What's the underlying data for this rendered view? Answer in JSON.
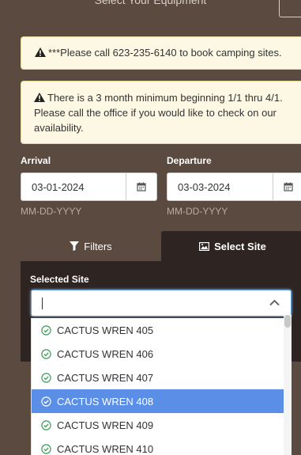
{
  "header": {
    "partial_title": "Select Your Equipment"
  },
  "alerts": {
    "phone_notice": "***Please call 623-235-6140 to book camping sites.",
    "minimum_notice": "There is a 3 month minimum beginning 1/1 thru 4/1. Please call the office if you would like to check on our availability."
  },
  "arrival": {
    "label": "Arrival",
    "value": "03-01-2024",
    "hint": "MM-DD-YYYY"
  },
  "departure": {
    "label": "Departure",
    "value": "03-03-2024",
    "hint": "MM-DD-YYYY"
  },
  "tabs": {
    "filters": "Filters",
    "select_site": "Select Site"
  },
  "site_select": {
    "label": "Selected Site",
    "value": "",
    "options": [
      "CACTUS WREN 405",
      "CACTUS WREN 406",
      "CACTUS WREN 407",
      "CACTUS WREN 408",
      "CACTUS WREN 409",
      "CACTUS WREN 410"
    ],
    "highlighted": "CACTUS WREN 408"
  },
  "colors": {
    "background": "#5a4a40",
    "panel": "#2e2422",
    "alert": "#fcf8e3",
    "highlight": "#5b8ee6"
  }
}
